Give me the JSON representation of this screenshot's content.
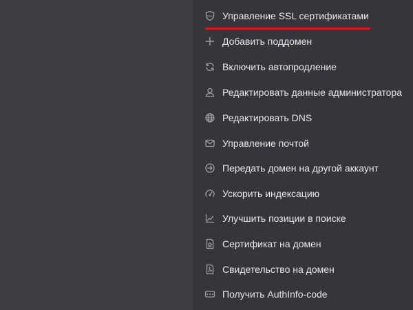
{
  "colors": {
    "background": "#3d3e43",
    "menu_bg": "#35363b",
    "text": "#e8e8ea",
    "icon": "#9ea0a8",
    "accent_underline": "#e0141b"
  },
  "menu": {
    "items": [
      {
        "label": "Управление SSL сертификатами",
        "icon": "ssl-shield-icon"
      },
      {
        "label": "Добавить поддомен",
        "icon": "plus-icon"
      },
      {
        "label": "Включить автопродление",
        "icon": "refresh-icon"
      },
      {
        "label": "Редактировать данные администратора",
        "icon": "user-icon"
      },
      {
        "label": "Редактировать DNS",
        "icon": "globe-icon"
      },
      {
        "label": "Управление почтой",
        "icon": "mail-icon"
      },
      {
        "label": "Передать домен на другой аккаунт",
        "icon": "arrow-circle-icon"
      },
      {
        "label": "Ускорить индексацию",
        "icon": "speedometer-icon"
      },
      {
        "label": "Улучшить позиции в поиске",
        "icon": "chart-line-icon"
      },
      {
        "label": "Сертификат на домен",
        "icon": "certificate-doc-icon"
      },
      {
        "label": "Свидетельство на домен",
        "icon": "pdf-doc-icon"
      },
      {
        "label": "Получить AuthInfo-code",
        "icon": "auth-code-icon"
      }
    ]
  }
}
